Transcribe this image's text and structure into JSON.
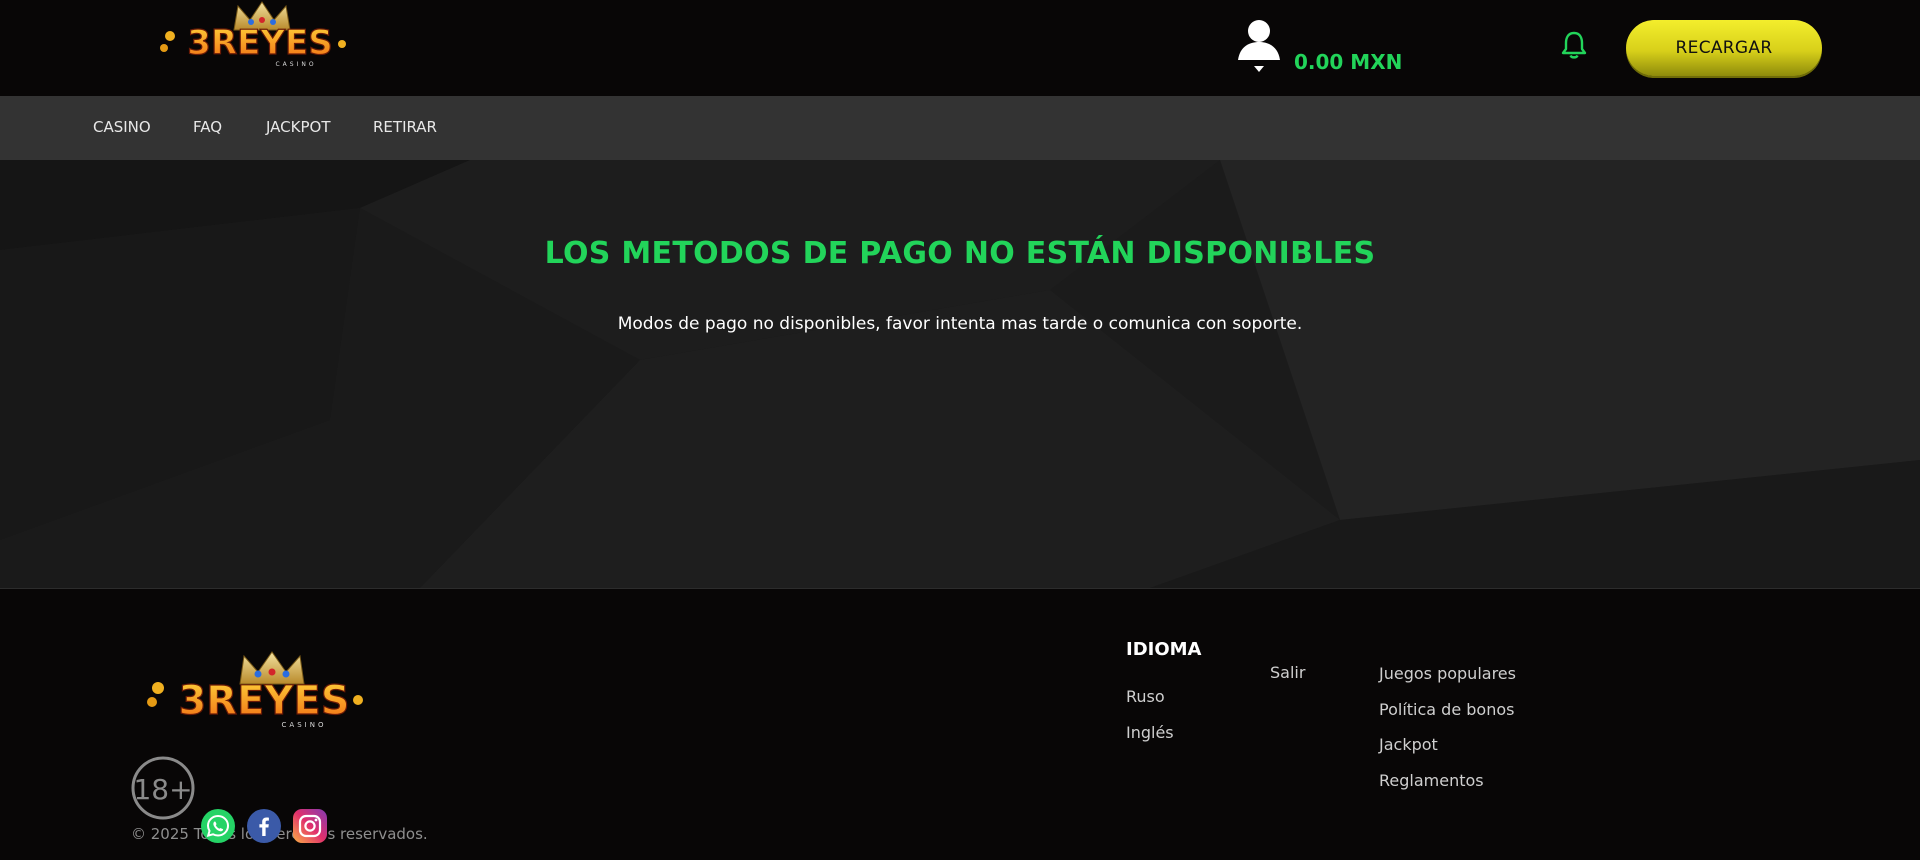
{
  "header": {
    "logo_text": "3REYES",
    "logo_sub": "CASINO",
    "balance": "0.00 MXN",
    "recharge_label": "RECARGAR"
  },
  "nav": {
    "items": [
      {
        "label": "CASINO"
      },
      {
        "label": "FAQ"
      },
      {
        "label": "JACKPOT"
      },
      {
        "label": "RETIRAR"
      }
    ]
  },
  "main": {
    "title": "LOS METODOS DE PAGO NO ESTÁN DISPONIBLES",
    "message": "Modos de pago no disponibles, favor intenta mas tarde o comunica con soporte."
  },
  "footer": {
    "language_heading": "IDIOMA",
    "languages": [
      {
        "label": "Ruso"
      },
      {
        "label": "Inglés"
      }
    ],
    "logout_label": "Salir",
    "links": [
      {
        "label": "Juegos populares"
      },
      {
        "label": "Política de bonos"
      },
      {
        "label": "Jackpot"
      },
      {
        "label": "Reglamentos"
      }
    ],
    "age_label": "18+",
    "copyright": "© 2025 Todos los derechos reservados.",
    "social": [
      {
        "icon": "whatsapp-icon",
        "color": "#25d366"
      },
      {
        "icon": "facebook-icon",
        "color": "#3b5aa8"
      },
      {
        "icon": "instagram-icon",
        "color": "#d6297a"
      }
    ]
  },
  "colors": {
    "accent_green": "#22d45a",
    "recharge_yellow": "#e6de1e",
    "nav_bg": "#333333",
    "page_bg": "#080606"
  }
}
